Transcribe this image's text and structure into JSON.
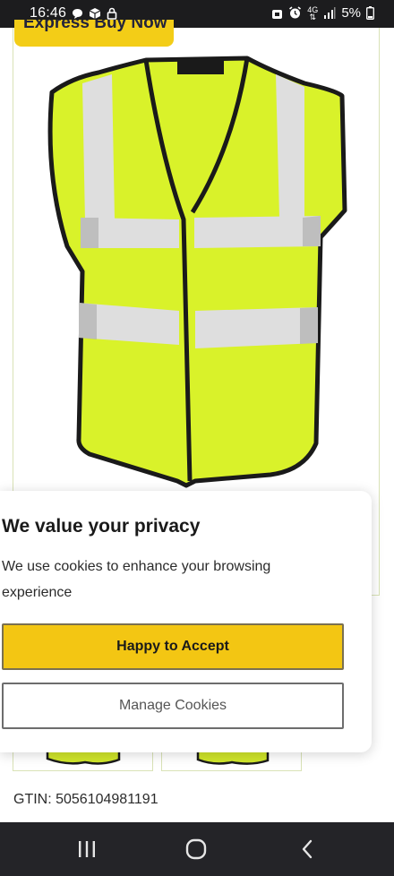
{
  "status_bar": {
    "time": "16:46",
    "battery": "5%"
  },
  "product": {
    "badge_text": "Express Buy Now",
    "image_alt": "Hi-vis yellow safety vest",
    "gtin": "GTIN: 5056104981191"
  },
  "cookie_banner": {
    "title": "We value your privacy",
    "text": "We use cookies to enhance your browsing experience",
    "accept_label": "Happy to Accept",
    "manage_label": "Manage Cookies"
  },
  "colors": {
    "accent_yellow": "#f3c613",
    "vest_yellow": "#d9f22a",
    "status_bar_bg": "#1c1c1e",
    "nav_bar_bg": "#242428"
  },
  "nav_bar": {
    "recents_icon": "recents-icon",
    "home_icon": "home-icon",
    "back_icon": "back-icon"
  }
}
